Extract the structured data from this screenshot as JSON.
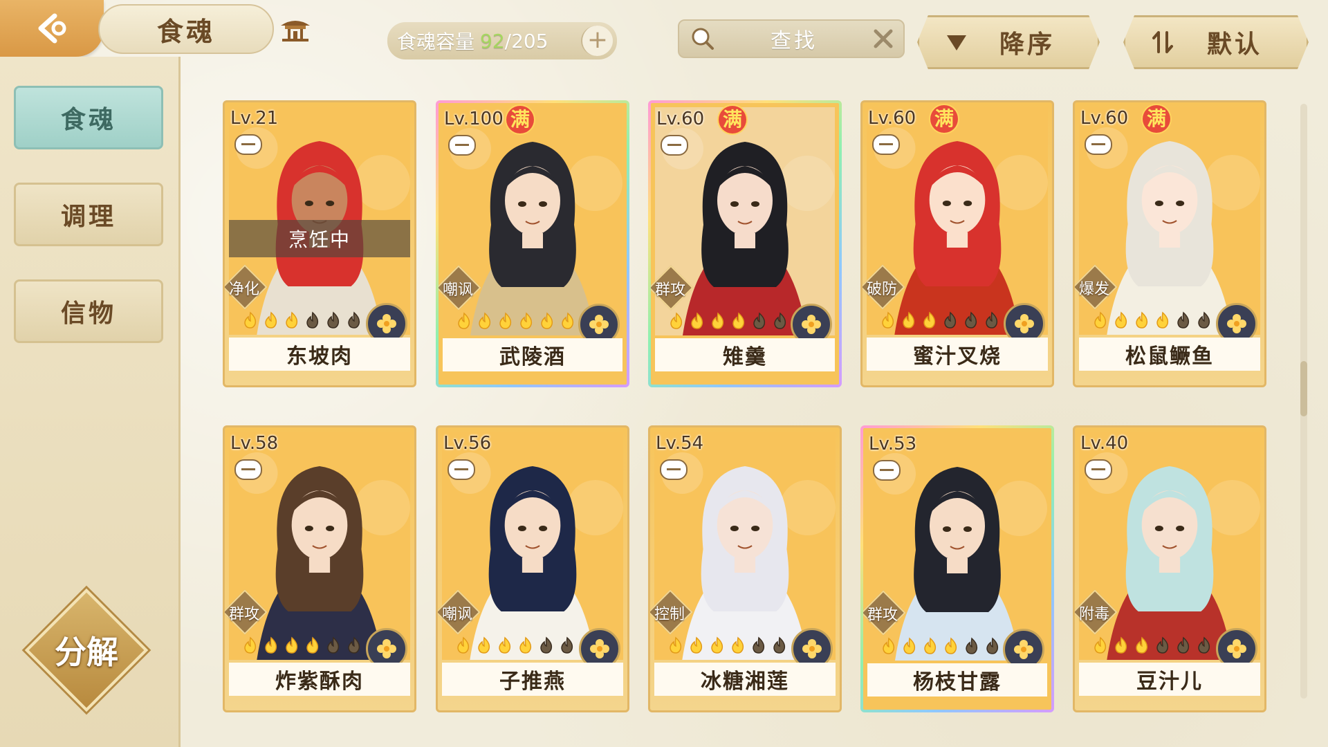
{
  "header": {
    "title": "食魂",
    "capacity_label": "食魂容量",
    "capacity_current": "92",
    "capacity_total": "/205",
    "capacity_add": "+",
    "search_text": "查找",
    "sort_order_label": "降序",
    "sort_mode_label": "默认"
  },
  "sidebar": {
    "items": [
      {
        "label": "食魂",
        "active": true
      },
      {
        "label": "调理",
        "active": false
      },
      {
        "label": "信物",
        "active": false
      }
    ],
    "decompose_label": "分解"
  },
  "colors": {
    "accent_teal": "#9fd0c7",
    "gold": "#e2b766",
    "green_count": "#a6d660",
    "full_badge": "#e84b3a"
  },
  "cards": [
    {
      "level": "Lv.21",
      "full": "",
      "role": "净化",
      "name": "东坡肉",
      "status": "烹饪中",
      "stars": 3,
      "rainbow": false,
      "hair": "#d8322d",
      "skin": "#c9855e",
      "outfit": "#e8e0d0",
      "bg": "#f8c35a"
    },
    {
      "level": "Lv.100",
      "full": "满",
      "role": "嘲讽",
      "name": "武陵酒",
      "status": "",
      "stars": 6,
      "rainbow": true,
      "hair": "#2a2a30",
      "skin": "#f6dcc6",
      "outfit": "#d8c08c",
      "bg": "#f8c35a"
    },
    {
      "level": "Lv.60",
      "full": "满",
      "role": "群攻",
      "name": "雉羹",
      "status": "",
      "stars": 4,
      "rainbow": true,
      "hair": "#1f1f24",
      "skin": "#f6dccb",
      "outfit": "#b8282a",
      "bg": "#f3d49b"
    },
    {
      "level": "Lv.60",
      "full": "满",
      "role": "破防",
      "name": "蜜汁叉烧",
      "status": "",
      "stars": 3,
      "rainbow": false,
      "hair": "#d8322d",
      "skin": "#fbe0cc",
      "outfit": "#c9341e",
      "bg": "#f8c35a"
    },
    {
      "level": "Lv.60",
      "full": "满",
      "role": "爆发",
      "name": "松鼠鳜鱼",
      "status": "",
      "stars": 4,
      "rainbow": false,
      "hair": "#e8e4da",
      "skin": "#fbe6d8",
      "outfit": "#f3efe2",
      "bg": "#f8c35a"
    },
    {
      "level": "Lv.58",
      "full": "",
      "role": "群攻",
      "name": "炸紫酥肉",
      "status": "",
      "stars": 4,
      "rainbow": false,
      "hair": "#5a3e2a",
      "skin": "#f6dcc6",
      "outfit": "#2d2f48",
      "bg": "#f8c35a"
    },
    {
      "level": "Lv.56",
      "full": "",
      "role": "嘲讽",
      "name": "子推燕",
      "status": "",
      "stars": 4,
      "rainbow": false,
      "hair": "#1e2848",
      "skin": "#f6dcc6",
      "outfit": "#f5f2ea",
      "bg": "#f8c35a"
    },
    {
      "level": "Lv.54",
      "full": "",
      "role": "控制",
      "name": "冰糖湘莲",
      "status": "",
      "stars": 4,
      "rainbow": false,
      "hair": "#e7e7ee",
      "skin": "#f6e2d6",
      "outfit": "#f1f1f4",
      "bg": "#f8c35a"
    },
    {
      "level": "Lv.53",
      "full": "",
      "role": "群攻",
      "name": "杨枝甘露",
      "status": "",
      "stars": 4,
      "rainbow": true,
      "hair": "#23252e",
      "skin": "#f6dcc6",
      "outfit": "#d6e4f0",
      "bg": "#f8c35a"
    },
    {
      "level": "Lv.40",
      "full": "",
      "role": "附毒",
      "name": "豆汁儿",
      "status": "",
      "stars": 3,
      "rainbow": false,
      "hair": "#bfe2e0",
      "skin": "#f6e0cf",
      "outfit": "#b8322a",
      "bg": "#f8c35a"
    }
  ]
}
